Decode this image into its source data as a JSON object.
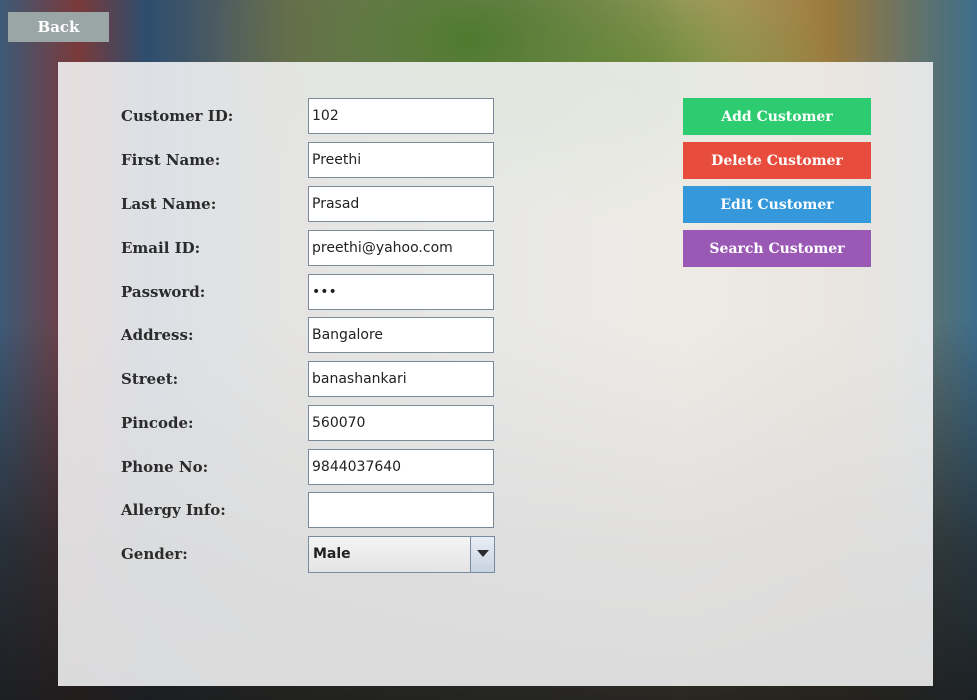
{
  "nav": {
    "back_label": "Back"
  },
  "form": {
    "fields": [
      {
        "label": "Customer ID:",
        "value": "102"
      },
      {
        "label": "First Name:",
        "value": "Preethi"
      },
      {
        "label": "Last Name:",
        "value": "Prasad"
      },
      {
        "label": "Email ID:",
        "value": "preethi@yahoo.com"
      },
      {
        "label": "Password:",
        "value": "•••"
      },
      {
        "label": "Address:",
        "value": "Bangalore"
      },
      {
        "label": "Street:",
        "value": "banashankari"
      },
      {
        "label": "Pincode:",
        "value": "560070"
      },
      {
        "label": "Phone No:",
        "value": "9844037640"
      },
      {
        "label": "Allergy Info:",
        "value": ""
      }
    ],
    "gender": {
      "label": "Gender:",
      "selected": "Male"
    }
  },
  "actions": {
    "add": {
      "label": "Add Customer",
      "color": "#2ecc71"
    },
    "delete": {
      "label": "Delete Customer",
      "color": "#e74c3c"
    },
    "edit": {
      "label": "Edit Customer",
      "color": "#3498db"
    },
    "search": {
      "label": "Search Customer",
      "color": "#9b59b6"
    }
  }
}
